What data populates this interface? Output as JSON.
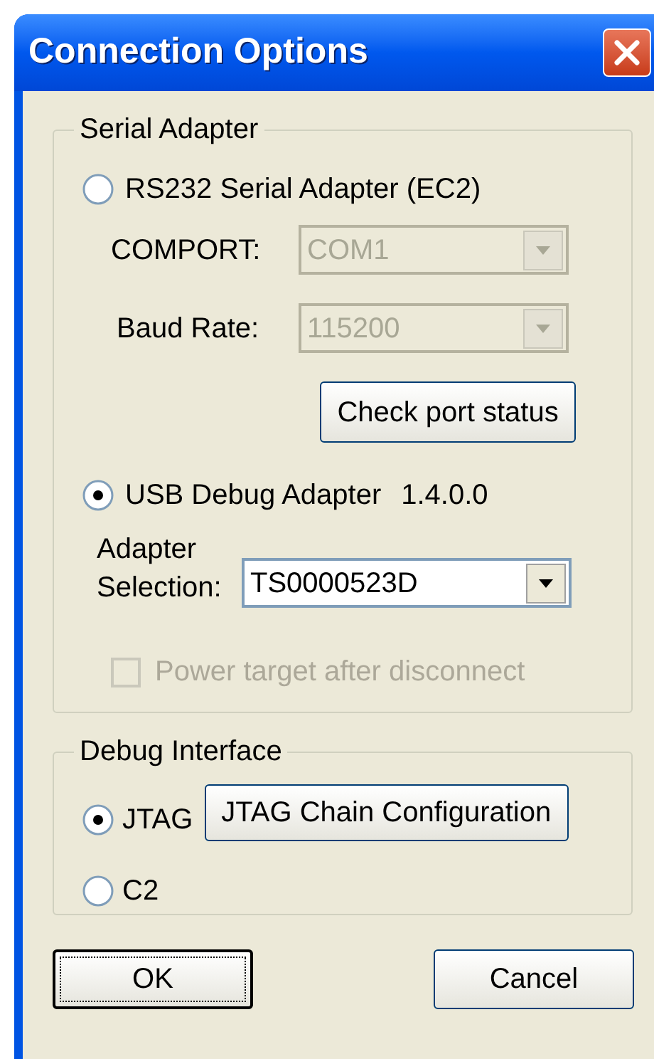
{
  "window": {
    "title": "Connection Options"
  },
  "serial_adapter": {
    "legend": "Serial Adapter",
    "rs232": {
      "label": "RS232 Serial Adapter (EC2)",
      "selected": false
    },
    "comport": {
      "label": "COMPORT:",
      "value": "COM1",
      "disabled": true
    },
    "baud_rate": {
      "label": "Baud Rate:",
      "value": "115200",
      "disabled": true
    },
    "check_port_button": {
      "label": "Check port status"
    },
    "usb": {
      "label": "USB Debug Adapter",
      "selected": true,
      "version": "1.4.0.0"
    },
    "adapter_selection": {
      "label": "Adapter Selection:",
      "value": "TS0000523D",
      "disabled": false
    },
    "power_target": {
      "label": "Power target after disconnect",
      "checked": false,
      "disabled": true
    }
  },
  "debug_interface": {
    "legend": "Debug Interface",
    "options": [
      {
        "label": "JTAG",
        "selected": true
      },
      {
        "label": "C2",
        "selected": false
      }
    ],
    "chain_button": {
      "label": "JTAG Chain Configuration"
    }
  },
  "buttons": [
    {
      "label": "OK",
      "default": true
    },
    {
      "label": "Cancel",
      "default": false
    }
  ]
}
